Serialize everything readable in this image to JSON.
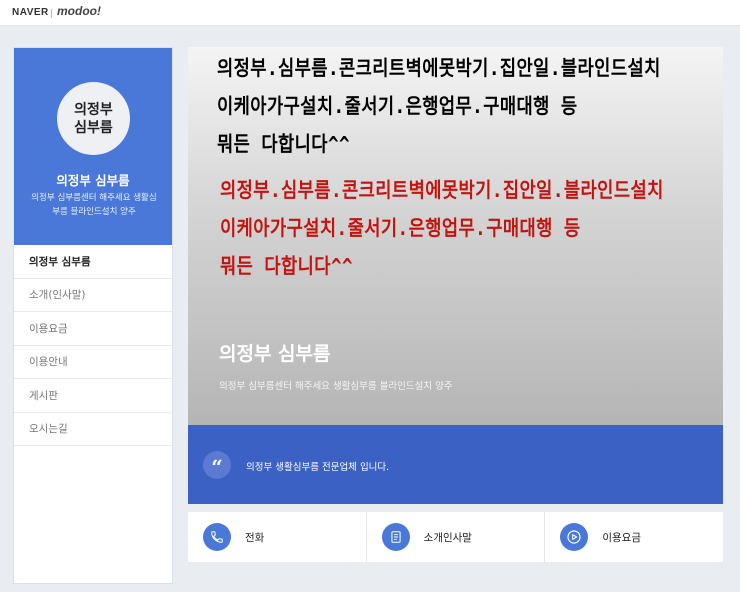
{
  "topbar": {
    "naver": "NAVER",
    "modoo": "modoo!"
  },
  "profile": {
    "avatar_text": "의정부 심부름",
    "name": "의정부 심부름",
    "description": "의정부 심부름센터 해주세요 생활심부름 블라인드설치 양주"
  },
  "nav": {
    "items": [
      {
        "label": "의정부 심부름"
      },
      {
        "label": "소개(인사말)"
      },
      {
        "label": "이용요금"
      },
      {
        "label": "이용안내"
      },
      {
        "label": "게시판"
      },
      {
        "label": "오시는길"
      }
    ]
  },
  "hero": {
    "handwriting_lines": [
      "의정부.심부름.콘크리트벽에못박기.집안일.블라인드설치",
      "이케아가구설치.줄서기.은행업무.구매대행 등",
      "뭐든 다합니다^^"
    ],
    "handwriting_colors": {
      "first": "#000000",
      "second": "#c4130f"
    },
    "title": "의정부 심부름",
    "subtitle": "의정부 심부름센터 해주세요 생활심부름 블라인드설치 양주"
  },
  "quote": {
    "mark": "“",
    "text": "의정부 생활심부름 전문업체 입니다."
  },
  "quick_links": [
    {
      "label": "전화",
      "icon": "phone-icon"
    },
    {
      "label": "소개인사말",
      "icon": "document-icon"
    },
    {
      "label": "이용요금",
      "icon": "play-icon"
    }
  ],
  "colors": {
    "accent": "#4a78d8",
    "quote_bg": "#3b61c4"
  }
}
